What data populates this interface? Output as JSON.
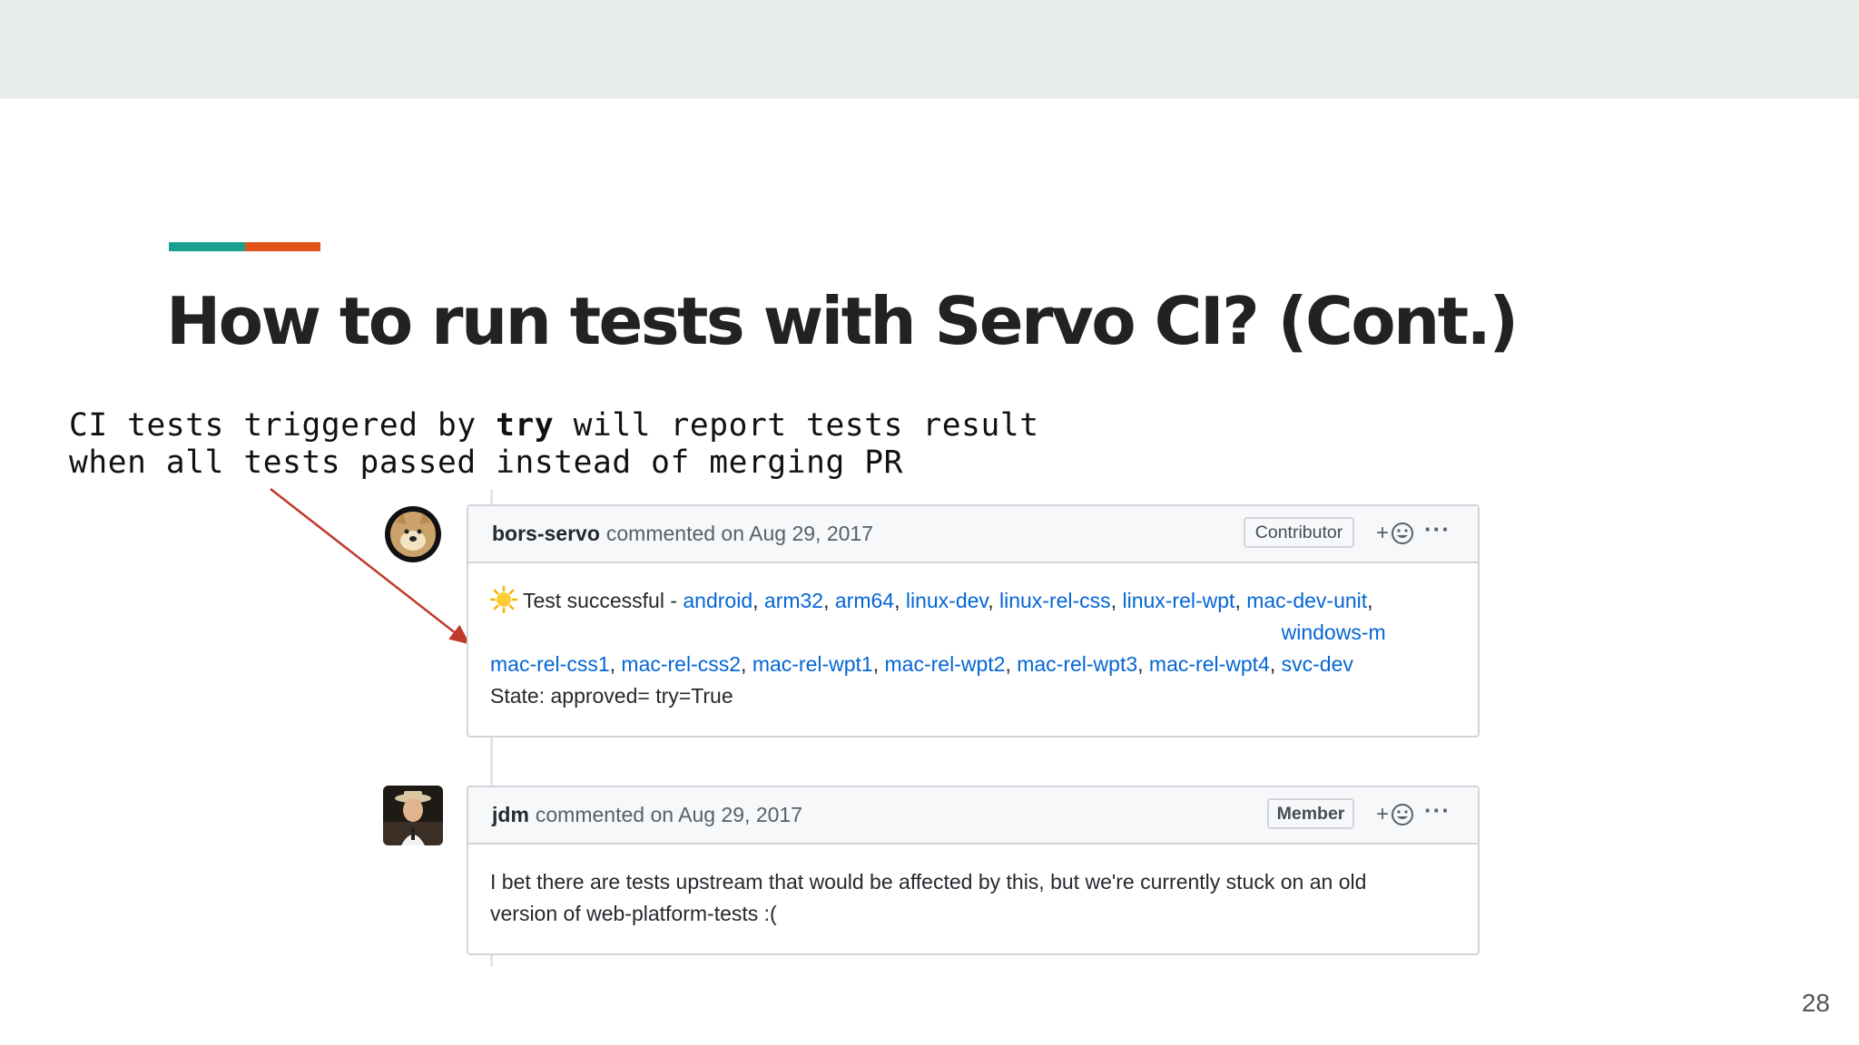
{
  "colors": {
    "topbar": "#e8eceb",
    "accent_teal": "#17a08c",
    "accent_orange": "#e2551a",
    "link": "#0366d6",
    "arrow": "#c0392b"
  },
  "slide": {
    "title": "How to run tests with Servo CI? (Cont.)",
    "note": {
      "line1_before": "CI tests triggered by ",
      "line1_keyword": "try",
      "line1_after": " will report tests result",
      "line2": "when all tests passed instead of merging PR"
    },
    "page_number": "28"
  },
  "comments": [
    {
      "author": "bors-servo",
      "meta": "commented on Aug 29, 2017",
      "badge": "Contributor",
      "avatar_icon": "doge-avatar-icon",
      "status_icon": "sun-emoji-icon",
      "status_text": "Test successful - ",
      "links": [
        "android",
        "arm32",
        "arm64",
        "linux-dev",
        "linux-rel-css",
        "linux-rel-wpt",
        "mac-dev-unit",
        "mac-rel-css1",
        "mac-rel-css2",
        "mac-rel-wpt1",
        "mac-rel-wpt2",
        "mac-rel-wpt3",
        "mac-rel-wpt4",
        "windows-msvc-dev"
      ],
      "state": "State: approved= try=True"
    },
    {
      "author": "jdm",
      "meta": "commented on Aug 29, 2017",
      "badge": "Member",
      "avatar_icon": "user-photo-avatar-icon",
      "body": "I bet there are tests upstream that would be affected by this, but we're currently stuck on an old version of web-platform-tests :("
    }
  ],
  "actions": {
    "reaction_label": "+",
    "reaction_icon": "smiley-icon",
    "more_label": "···",
    "more_icon": "kebab-menu-icon"
  }
}
